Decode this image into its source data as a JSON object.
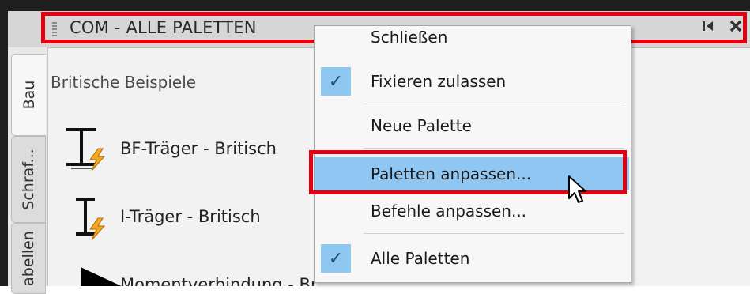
{
  "palette": {
    "title": "COM - ALLE PALETTEN",
    "pin_icon": "pin-icon",
    "close_icon": "close-icon",
    "tabs": [
      "Bau",
      "Schraf...",
      "abellen"
    ],
    "section_title": "Britische Beispiele",
    "items": [
      {
        "label": "BF-Träger - Britisch",
        "icon": "bf-beam-icon"
      },
      {
        "label": "I-Träger - Britisch",
        "icon": "i-beam-icon"
      },
      {
        "label": "Momentverbindung - Britisch",
        "icon": "moment-connection-icon"
      }
    ]
  },
  "context_menu": {
    "items": [
      {
        "label": "Schließen",
        "checked": false
      },
      {
        "label": "Fixieren zulassen",
        "checked": true
      },
      {
        "label": "Neue Palette",
        "checked": false
      },
      {
        "label": "Paletten anpassen...",
        "checked": false,
        "hovered": true
      },
      {
        "label": "Befehle anpassen...",
        "checked": false
      },
      {
        "label": "Alle Paletten",
        "checked": true
      }
    ]
  },
  "colors": {
    "highlight": "#e3000f",
    "hover": "#8fc6f2",
    "check_bg": "#8ec7f0"
  }
}
